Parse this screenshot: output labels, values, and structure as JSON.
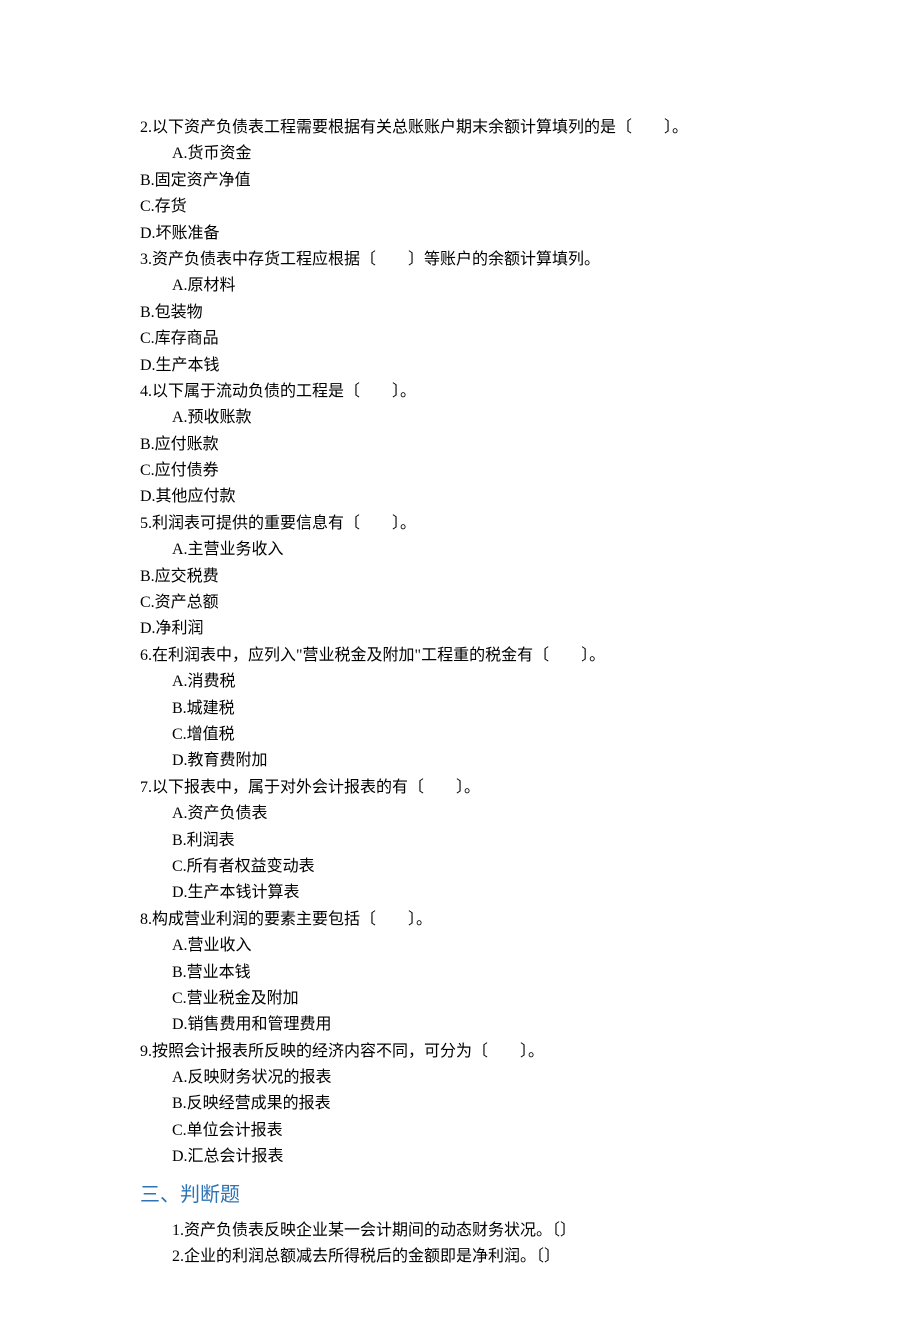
{
  "questions": [
    {
      "stem": "2.以下资产负债表工程需要根据有关总账账户期末余额计算填列的是〔　　〕。",
      "options": [
        {
          "text": "A.货币资金",
          "indent": 1
        },
        {
          "text": "B.固定资产净值",
          "indent": 0
        },
        {
          "text": "C.存货",
          "indent": 0
        },
        {
          "text": "D.坏账准备",
          "indent": 0
        }
      ]
    },
    {
      "stem": "3.资产负债表中存货工程应根据〔　　〕等账户的余额计算填列。",
      "options": [
        {
          "text": "A.原材料",
          "indent": 1
        },
        {
          "text": "B.包装物",
          "indent": 0
        },
        {
          "text": "C.库存商品",
          "indent": 0
        },
        {
          "text": "D.生产本钱",
          "indent": 0
        }
      ]
    },
    {
      "stem": "4.以下属于流动负债的工程是〔　　〕。",
      "options": [
        {
          "text": "A.预收账款",
          "indent": 1
        },
        {
          "text": "B.应付账款",
          "indent": 0
        },
        {
          "text": "C.应付债券",
          "indent": 0
        },
        {
          "text": "D.其他应付款",
          "indent": 0
        }
      ]
    },
    {
      "stem": "5.利润表可提供的重要信息有〔　　〕。",
      "options": [
        {
          "text": "A.主营业务收入",
          "indent": 1
        },
        {
          "text": "B.应交税费",
          "indent": 0
        },
        {
          "text": "C.资产总额",
          "indent": 0
        },
        {
          "text": "D.净利润",
          "indent": 0
        }
      ]
    },
    {
      "stem": "6.在利润表中，应列入\"营业税金及附加\"工程重的税金有〔　　〕。",
      "options": [
        {
          "text": "A.消费税",
          "indent": 1
        },
        {
          "text": "B.城建税",
          "indent": 1
        },
        {
          "text": "C.增值税",
          "indent": 1
        },
        {
          "text": "D.教育费附加",
          "indent": 1
        }
      ]
    },
    {
      "stem": "7.以下报表中，属于对外会计报表的有〔　　〕。",
      "options": [
        {
          "text": "A.资产负债表",
          "indent": 1
        },
        {
          "text": "B.利润表",
          "indent": 1
        },
        {
          "text": "C.所有者权益变动表",
          "indent": 1
        },
        {
          "text": "D.生产本钱计算表",
          "indent": 1
        }
      ]
    },
    {
      "stem": "8.构成营业利润的要素主要包括〔　　〕。",
      "options": [
        {
          "text": "A.营业收入",
          "indent": 1
        },
        {
          "text": "B.营业本钱",
          "indent": 1
        },
        {
          "text": "C.营业税金及附加",
          "indent": 1
        },
        {
          "text": "D.销售费用和管理费用",
          "indent": 1
        }
      ]
    },
    {
      "stem": "9.按照会计报表所反映的经济内容不同，可分为〔　　〕。",
      "options": [
        {
          "text": "A.反映财务状况的报表",
          "indent": 1
        },
        {
          "text": "B.反映经营成果的报表",
          "indent": 1
        },
        {
          "text": "C.单位会计报表",
          "indent": 1
        },
        {
          "text": "D.汇总会计报表",
          "indent": 1
        }
      ]
    }
  ],
  "sectionHead": "三、判断题",
  "tfItems": [
    "1.资产负债表反映企业某一会计期间的动态财务状况。〔〕",
    "2.企业的利润总额减去所得税后的金额即是净利润。〔〕"
  ]
}
